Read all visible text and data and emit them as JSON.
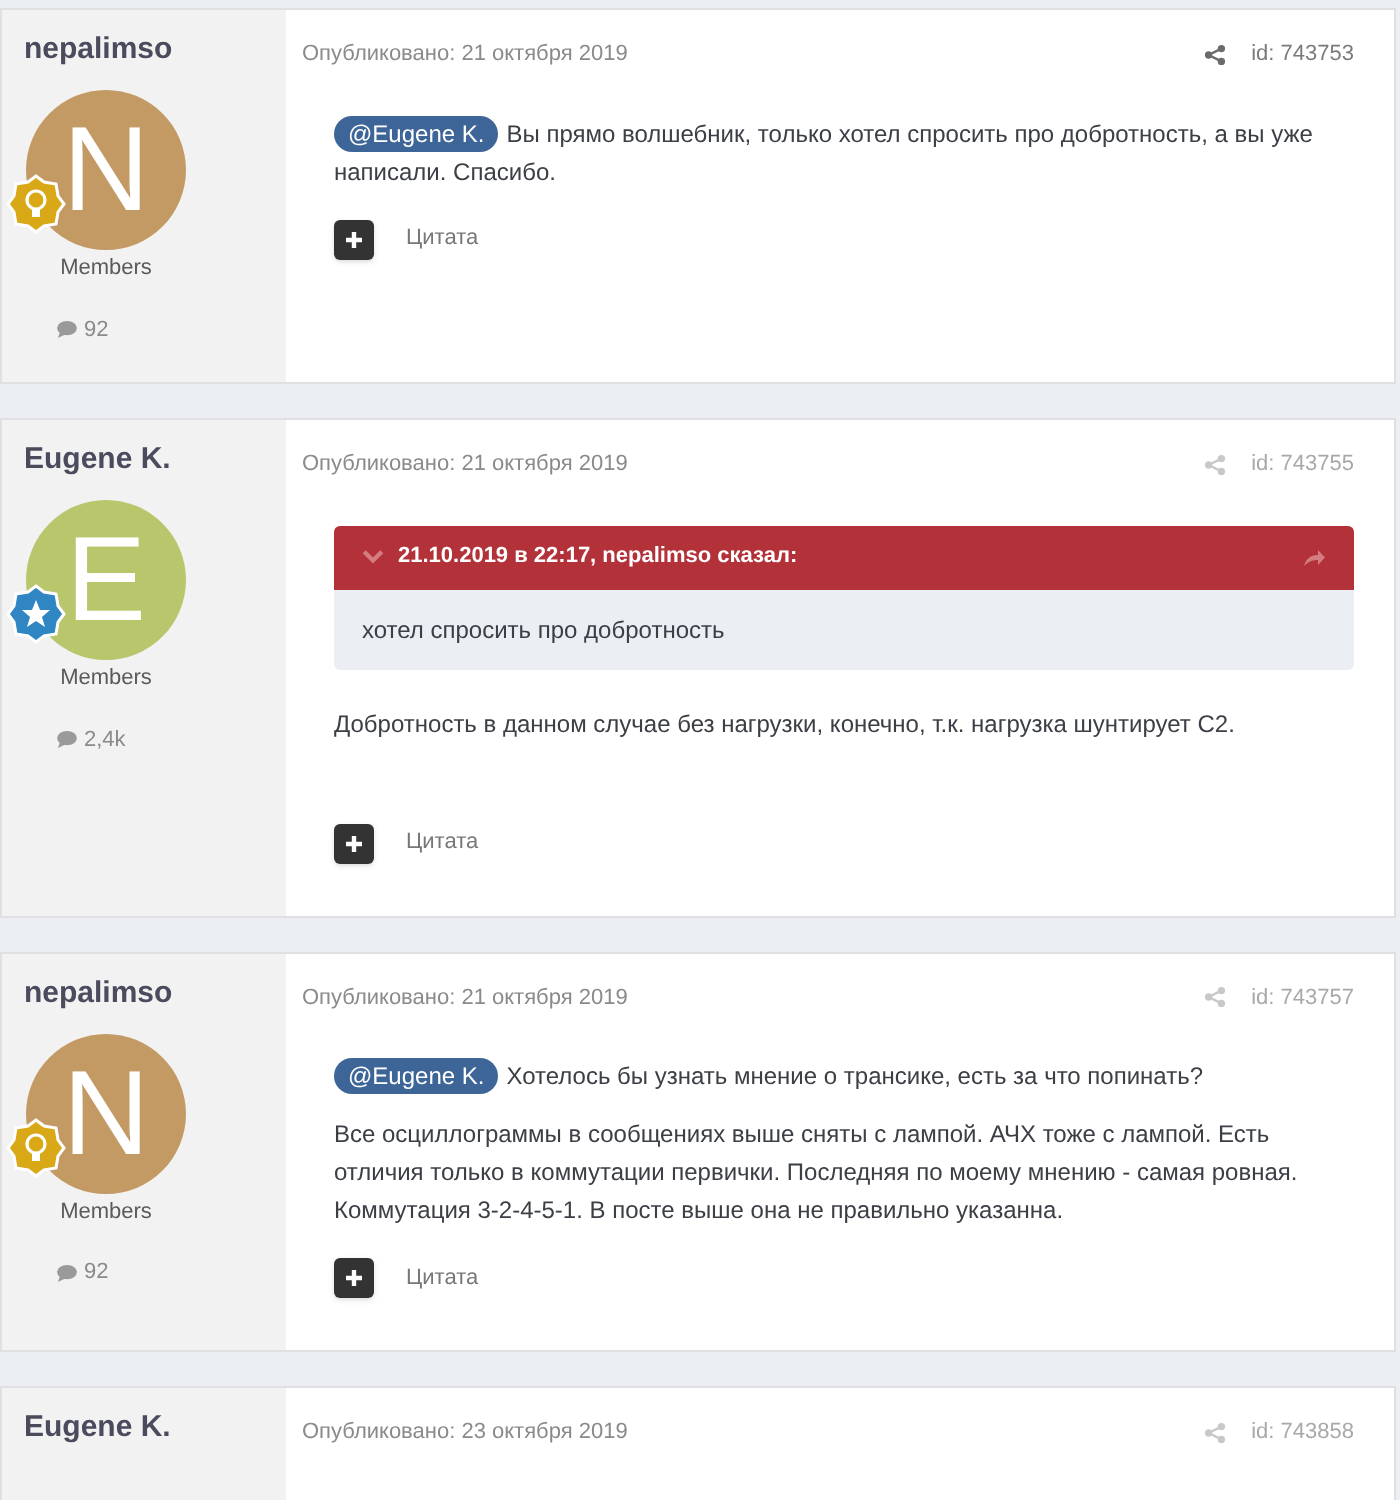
{
  "posts": [
    {
      "author": "nepalimso",
      "avatar": {
        "letter": "N",
        "color": "#c49a64",
        "badge": {
          "kind": "bulb"
        }
      },
      "group": "Members",
      "count": "92",
      "date": "Опубликовано: 21 октября 2019",
      "id": "id: 743753",
      "actions_emphasized": true,
      "body": [
        {
          "kind": "paragraph",
          "mention": "@Eugene K.",
          "text": "Вы прямо волшебник, только хотел спросить про добротность, а вы уже написали. Спасибо."
        }
      ],
      "quote_label": "Цитата"
    },
    {
      "author": "Eugene K.",
      "avatar": {
        "letter": "E",
        "color": "#bac66b",
        "badge": {
          "kind": "star"
        }
      },
      "group": "Members",
      "count": "2,4k",
      "date": "Опубликовано: 21 октября 2019",
      "id": "id: 743755",
      "actions_emphasized": false,
      "body": [
        {
          "kind": "quote",
          "header": "21.10.2019 в 22:17, nepalimso сказал:",
          "text": "хотел спросить про добротность"
        },
        {
          "kind": "paragraph",
          "text": "Добротность в данном случае без нагрузки, конечно, т.к. нагрузка шунтирует С2."
        }
      ],
      "quote_label": "Цитата"
    },
    {
      "author": "nepalimso",
      "avatar": {
        "letter": "N",
        "color": "#c49a64",
        "badge": {
          "kind": "bulb"
        }
      },
      "group": "Members",
      "count": "92",
      "date": "Опубликовано: 21 октября 2019",
      "id": "id: 743757",
      "actions_emphasized": false,
      "body": [
        {
          "kind": "paragraph",
          "mention": "@Eugene K.",
          "text": "Хотелось бы узнать мнение о трансике, есть за что попинать?"
        },
        {
          "kind": "paragraph",
          "text": "Все осциллограммы в сообщениях выше сняты с лампой.  АЧХ тоже с лампой. Есть отличия только в коммутации первички. Последняя по моему мнению - самая ровная. Коммутация 3-2-4-5-1. В посте выше она не правильно указанна."
        }
      ],
      "quote_label": "Цитата"
    },
    {
      "author": "Eugene K.",
      "date": "Опубликовано: 23 октября 2019",
      "id": "id: 743858",
      "actions_emphasized": false
    }
  ]
}
